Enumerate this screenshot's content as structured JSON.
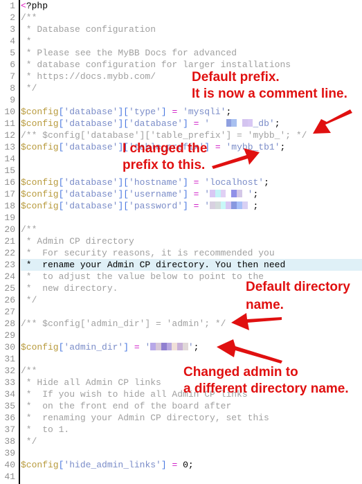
{
  "editor": {
    "highlighted_line": 23,
    "lines": [
      [
        [
          "tag",
          "<"
        ],
        [
          "kw",
          "?php"
        ]
      ],
      [
        [
          "com",
          "/**"
        ]
      ],
      [
        [
          "com",
          " * Database configuration"
        ]
      ],
      [
        [
          "com",
          " *"
        ]
      ],
      [
        [
          "com",
          " * Please see the MyBB Docs for advanced"
        ]
      ],
      [
        [
          "com",
          " * database configuration for larger installations"
        ]
      ],
      [
        [
          "com",
          " * https://docs.mybb.com/"
        ]
      ],
      [
        [
          "com",
          " */"
        ]
      ],
      [],
      [
        [
          "var",
          "$config"
        ],
        [
          "br",
          "["
        ],
        [
          "str",
          "'database'"
        ],
        [
          "br",
          "]["
        ],
        [
          "str",
          "'type'"
        ],
        [
          "br",
          "]"
        ],
        [
          "op",
          " = "
        ],
        [
          "str",
          "'mysqli'"
        ],
        [
          "semi",
          ";"
        ]
      ],
      [
        [
          "var",
          "$config"
        ],
        [
          "br",
          "["
        ],
        [
          "str",
          "'database'"
        ],
        [
          "br",
          "]["
        ],
        [
          "str",
          "'database'"
        ],
        [
          "br",
          "]"
        ],
        [
          "op",
          " = "
        ],
        [
          "str",
          "'   "
        ],
        [
          "blur",
          [
            "#8fa0e0",
            "#a8c0f0",
            " ",
            "#d4c4f0",
            "#d8c8f4"
          ]
        ],
        [
          "str",
          "_db'"
        ],
        [
          "semi",
          ";"
        ]
      ],
      [
        [
          "com",
          "/** $config['database']['table_prefix'] = 'mybb_'; */"
        ]
      ],
      [
        [
          "var",
          "$config"
        ],
        [
          "br",
          "["
        ],
        [
          "str",
          "'database'"
        ],
        [
          "br",
          "]["
        ],
        [
          "str",
          "'table_prefix'"
        ],
        [
          "br",
          "]"
        ],
        [
          "op",
          " = "
        ],
        [
          "str",
          "'mybb_tb1'"
        ],
        [
          "semi",
          ";"
        ]
      ],
      [],
      [],
      [
        [
          "var",
          "$config"
        ],
        [
          "br",
          "["
        ],
        [
          "str",
          "'database'"
        ],
        [
          "br",
          "]["
        ],
        [
          "str",
          "'hostname'"
        ],
        [
          "br",
          "]"
        ],
        [
          "op",
          " = "
        ],
        [
          "str",
          "'localhost'"
        ],
        [
          "semi",
          ";"
        ]
      ],
      [
        [
          "var",
          "$config"
        ],
        [
          "br",
          "["
        ],
        [
          "str",
          "'database'"
        ],
        [
          "br",
          "]["
        ],
        [
          "str",
          "'username'"
        ],
        [
          "br",
          "]"
        ],
        [
          "op",
          " = "
        ],
        [
          "str",
          "'"
        ],
        [
          "blur",
          [
            "#d8c8f4",
            "#c4f4f8",
            "#e0d0f4",
            " ",
            "#9090e8",
            "#d4c8e8",
            " "
          ]
        ],
        [
          "str",
          "'"
        ],
        [
          "semi",
          ";"
        ]
      ],
      [
        [
          "var",
          "$config"
        ],
        [
          "br",
          "["
        ],
        [
          "str",
          "'database'"
        ],
        [
          "br",
          "]["
        ],
        [
          "str",
          "'password'"
        ],
        [
          "br",
          "]"
        ],
        [
          "op",
          " = "
        ],
        [
          "str",
          "'"
        ],
        [
          "blur",
          [
            "#d8d0e0",
            "#d4dcdc",
            "#c8f8f8",
            "#d8c8f4",
            "#8898e0",
            "#a8c0f8",
            "#d8d0f4",
            " "
          ]
        ],
        [
          "semi",
          ";"
        ]
      ],
      [],
      [
        [
          "com",
          "/**"
        ]
      ],
      [
        [
          "com",
          " * Admin CP directory"
        ]
      ],
      [
        [
          "com",
          " *  For security reasons, it is recommended you"
        ]
      ],
      [
        [
          "hlcom",
          " *  rename your Admin CP directory. You then need"
        ]
      ],
      [
        [
          "com",
          " *  to adjust the value below to point to the"
        ]
      ],
      [
        [
          "com",
          " *  new directory."
        ]
      ],
      [
        [
          "com",
          " */"
        ]
      ],
      [],
      [
        [
          "com",
          "/** $config['admin_dir'] = 'admin'; */"
        ]
      ],
      [],
      [
        [
          "var",
          "$config"
        ],
        [
          "br",
          "["
        ],
        [
          "str",
          "'admin_dir'"
        ],
        [
          "br",
          "]"
        ],
        [
          "op",
          " = "
        ],
        [
          "str",
          "'"
        ],
        [
          "blur",
          [
            "#b8a8e8",
            "#d8c8d8",
            "#9080d0",
            "#b8a8e0",
            "#f0e0d8",
            "#c8b0d8",
            "#e0d8d8"
          ]
        ],
        [
          "str",
          "'"
        ],
        [
          "semi",
          ";"
        ]
      ],
      [],
      [
        [
          "com",
          "/**"
        ]
      ],
      [
        [
          "com",
          " * Hide all Admin CP links"
        ]
      ],
      [
        [
          "com",
          " *  If you wish to hide all Admin CP links"
        ]
      ],
      [
        [
          "com",
          " *  on the front end of the board after"
        ]
      ],
      [
        [
          "com",
          " *  renaming your Admin CP directory, set this"
        ]
      ],
      [
        [
          "com",
          " *  to 1."
        ]
      ],
      [
        [
          "com",
          " */"
        ]
      ],
      [],
      [
        [
          "var",
          "$config"
        ],
        [
          "br",
          "["
        ],
        [
          "str",
          "'hide_admin_links'"
        ],
        [
          "br",
          "]"
        ],
        [
          "op",
          " = "
        ],
        [
          "num",
          "0"
        ],
        [
          "semi",
          ";"
        ]
      ],
      []
    ]
  },
  "annotations": {
    "prefix_default": [
      "Default prefix.",
      "It is now a comment line."
    ],
    "prefix_changed": [
      "I changed the",
      "prefix to this."
    ],
    "dir_default": [
      "Default directory",
      "name."
    ],
    "dir_changed": [
      "Changed admin to",
      "a different directory name."
    ],
    "color": "#e01010"
  }
}
